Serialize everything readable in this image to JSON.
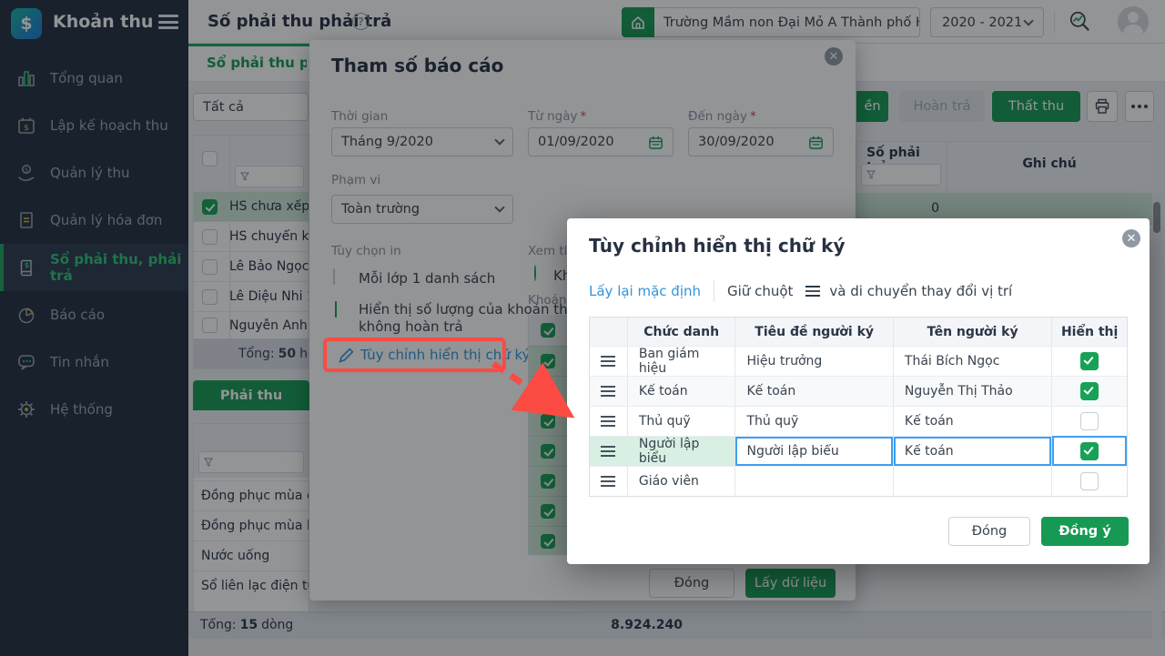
{
  "app": {
    "name": "Khoản thu"
  },
  "icons": {
    "help_glyph": "?",
    "logo_dollar": "$",
    "plan_dollar": "$",
    "ledger_dollar": "$",
    "coin_dollar": "$"
  },
  "sidebar": {
    "items": [
      {
        "label": "Tổng quan",
        "active": false
      },
      {
        "label": "Lập kế hoạch thu",
        "active": false
      },
      {
        "label": "Quản lý thu",
        "active": false
      },
      {
        "label": "Quản lý hóa đơn",
        "active": false
      },
      {
        "label": "Sổ phải thu, phải trả",
        "active": true
      },
      {
        "label": "Báo cáo",
        "active": false
      },
      {
        "label": "Tin nhắn",
        "active": false
      },
      {
        "label": "Hệ thống",
        "active": false
      }
    ]
  },
  "header": {
    "page_title": "Số phải thu phải trả",
    "school_name": "Trường Mầm non Đại Mỏ A Thành phố Hà Nội",
    "school_year": "2020 - 2021"
  },
  "content": {
    "tab_label": "Sổ phải thu phải",
    "scope_filter": "Tất cả",
    "student_list": {
      "rows": [
        {
          "name": "HS chưa xếp",
          "checked": true
        },
        {
          "name": "HS chuyển kh",
          "checked": false
        },
        {
          "name": "Lê Bảo Ngọc",
          "checked": false
        },
        {
          "name": "Lê Diệu Nhi 1",
          "checked": false
        },
        {
          "name": "Nguyễn Anh",
          "checked": false
        }
      ],
      "total_prefix": "Tổng:",
      "total_count": "50",
      "total_suffix": "học"
    },
    "action_buttons": {
      "collect_fragment": "ền",
      "refund": "Hoàn trả",
      "loss": "Thất thu"
    },
    "receivable_table": {
      "col_amount": "Số phải trả",
      "col_note": "Ghi chú",
      "selected_value": "0"
    },
    "fee_panel": {
      "tab": "Phải thu",
      "rows": [
        "Đồng phục mùa đô",
        "Đồng phục mùa hè",
        "Nước uống",
        "Sổ liên lạc điện tử"
      ],
      "total_prefix": "Tổng:",
      "total_count": "15",
      "total_suffix": "dòng",
      "grand_total": "8.924.240"
    }
  },
  "report_modal": {
    "title": "Tham số báo cáo",
    "required_mark": "*",
    "time_label": "Thời gian",
    "time_value": "Tháng 9/2020",
    "from_label": "Từ ngày",
    "from_value": "01/09/2020",
    "to_label": "Đến ngày",
    "to_value": "30/09/2020",
    "scope_label": "Phạm vi",
    "scope_value": "Toàn trường",
    "print_options_label": "Tùy chọn in",
    "option1": "Mỗi lớp 1 danh sách",
    "option2": "Hiển thị số lượng của khoản thu không hoàn trả",
    "signature_link": "Tùy chỉnh hiển thị chữ ký",
    "view_by_label": "Xem the",
    "radio_label": "Kh",
    "fee_section_label": "Khoản t",
    "close_button": "Đóng",
    "submit_button": "Lấy dữ liệu"
  },
  "signature_modal": {
    "title": "Tùy chỉnh hiển thị chữ ký",
    "reset_link": "Lấy lại mặc định",
    "hint_before": "Giữ chuột",
    "hint_after": "và di chuyển thay đổi vị trí",
    "headers": {
      "role": "Chức danh",
      "sign_title": "Tiêu đề người ký",
      "signer": "Tên người ký",
      "visible": "Hiển thị"
    },
    "rows": [
      {
        "role": "Ban giám hiệu",
        "sign_title": "Hiệu trưởng",
        "signer": "Thái Bích Ngọc",
        "visible": true,
        "editing": false
      },
      {
        "role": "Kế toán",
        "sign_title": "Kế toán",
        "signer": "Nguyễn Thị Thảo",
        "visible": true,
        "editing": false
      },
      {
        "role": "Thủ quỹ",
        "sign_title": "Thủ quỹ",
        "signer": "Kế toán",
        "visible": false,
        "editing": false
      },
      {
        "role": "Người lập biểu",
        "sign_title": "Người lập biểu",
        "signer": "Kế toán",
        "visible": true,
        "editing": true
      },
      {
        "role": "Giáo viên",
        "sign_title": "",
        "signer": "",
        "visible": false,
        "editing": false
      }
    ],
    "close_button": "Đóng",
    "ok_button": "Đồng ý"
  },
  "colors": {
    "primary_green": "#169a53",
    "checkbox_green": "#17a257",
    "link_blue": "#2f96dd",
    "edit_border_blue": "#3f9ff0",
    "annotation_red": "#fb4b42",
    "sidebar_bg": "#232e3e",
    "selected_row_green": "#cfe7d8"
  }
}
